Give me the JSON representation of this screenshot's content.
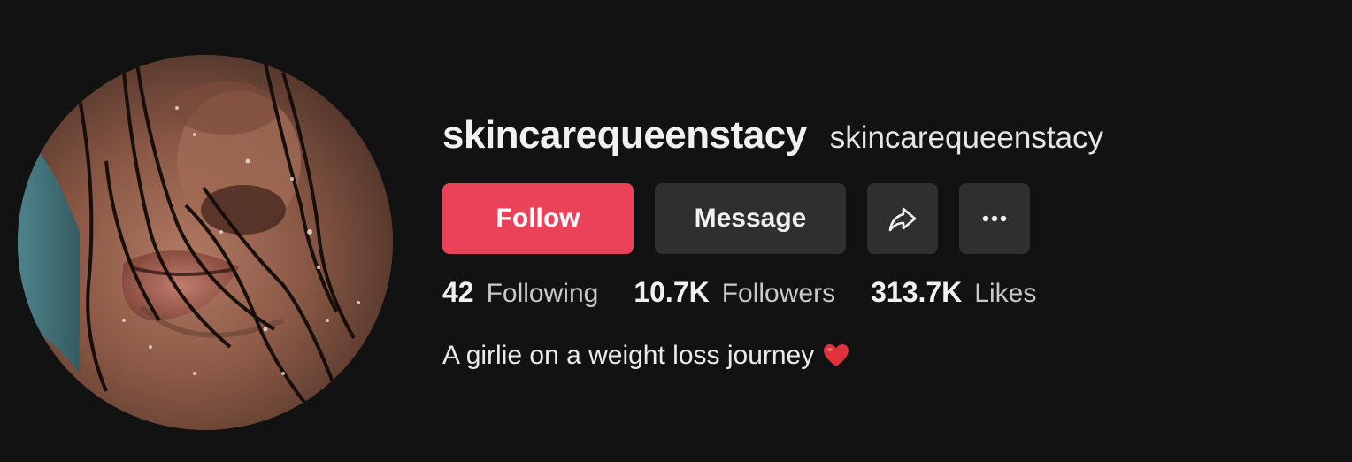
{
  "profile": {
    "username": "skincarequeenstacy",
    "nickname": "skincarequeenstacy",
    "avatar_icon": "profile-photo",
    "bio": "A girlie on a weight loss journey",
    "bio_emoji_icon": "red-heart-icon"
  },
  "actions": {
    "follow_label": "Follow",
    "message_label": "Message",
    "share_icon": "share-arrow-icon",
    "more_icon": "more-options-icon"
  },
  "stats": [
    {
      "value": "42",
      "label": "Following"
    },
    {
      "value": "10.7K",
      "label": "Followers"
    },
    {
      "value": "313.7K",
      "label": "Likes"
    }
  ],
  "colors": {
    "background": "#121212",
    "follow_button": "#ea4359",
    "secondary_button": "#2f2f2f",
    "heart": "#e0323b"
  }
}
